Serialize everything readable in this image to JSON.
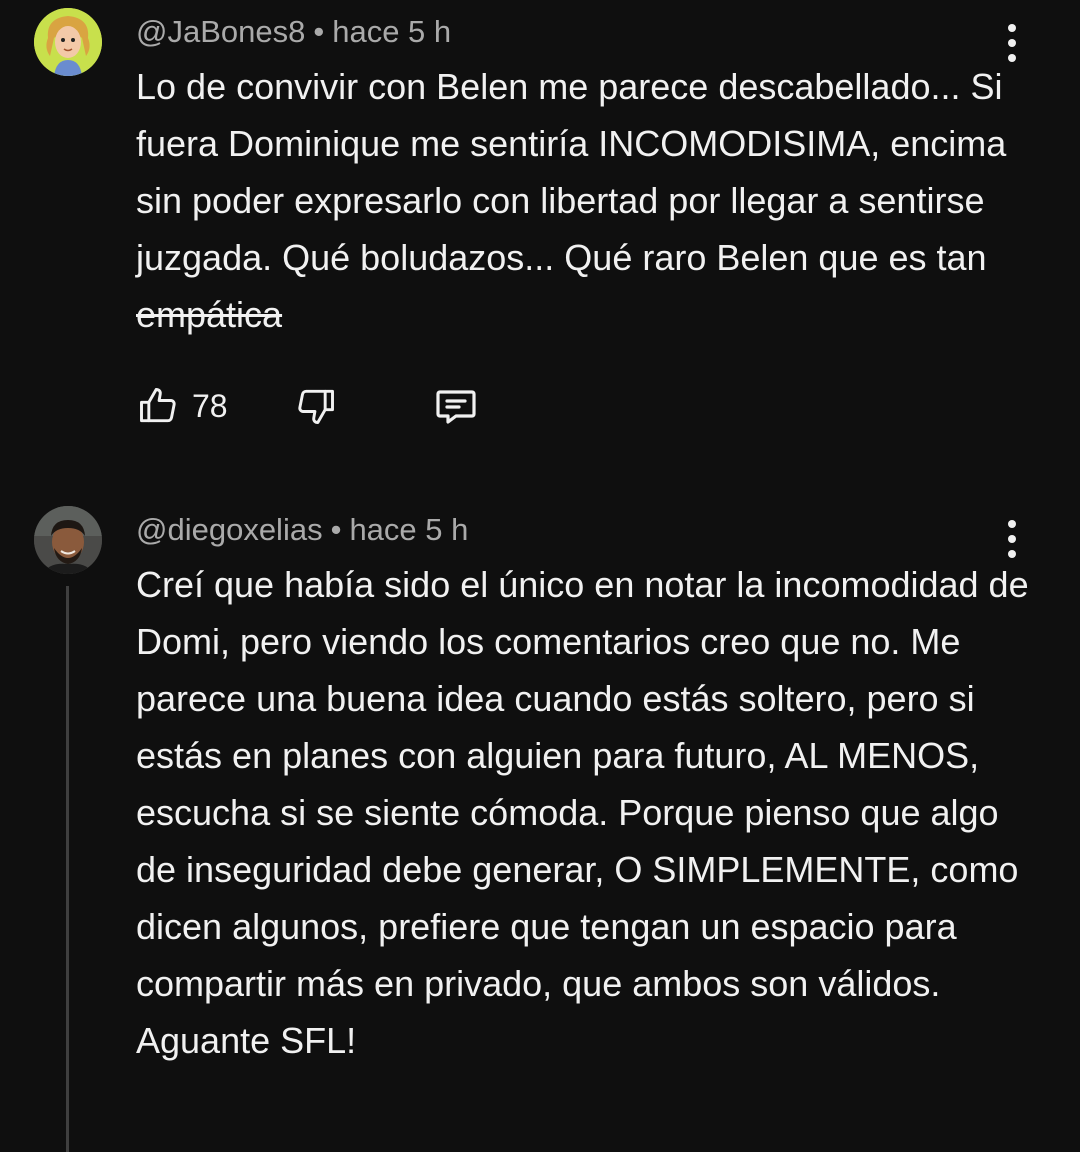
{
  "comments": [
    {
      "author": "@JaBones8",
      "separator": "•",
      "time": "hace 5 h",
      "text_plain": "Lo de convivir con Belen me parece descabellado... Si fuera Dominique me sentiría INCOMODISIMA, encima sin poder expresarlo con libertad por llegar a sentirse juzgada. Qué boludazos... Qué raro Belen que es tan ",
      "text_strike": "empática",
      "likes": "78",
      "avatar_icon": "cartoon-girl-avatar",
      "avatar_bg": "#c8e04c"
    },
    {
      "author": "@diegoxelias",
      "separator": "•",
      "time": "hace 5 h",
      "text_plain": "Creí que había sido el único en notar la incomodidad de Domi, pero viendo los comentarios creo que no. Me parece una buena idea cuando estás soltero, pero si estás en planes con alguien para futuro, AL MENOS, escucha si se siente cómoda. Porque pienso que algo de inseguridad debe generar, O SIMPLEMENTE, como dicen algunos, prefiere que tengan un espacio para compartir más en privado, que ambos son válidos. Aguante SFL!",
      "avatar_icon": "man-photo-avatar",
      "avatar_bg": "#3a3a3a"
    }
  ],
  "icons": {
    "like": "thumbs-up-icon",
    "dislike": "thumbs-down-icon",
    "reply": "reply-comment-icon",
    "menu": "more-vertical-icon"
  },
  "colors": {
    "background": "#0f0f0f",
    "text": "#f1f1f1",
    "meta": "#aaaaaa",
    "thread_line": "#3f3f3f"
  }
}
